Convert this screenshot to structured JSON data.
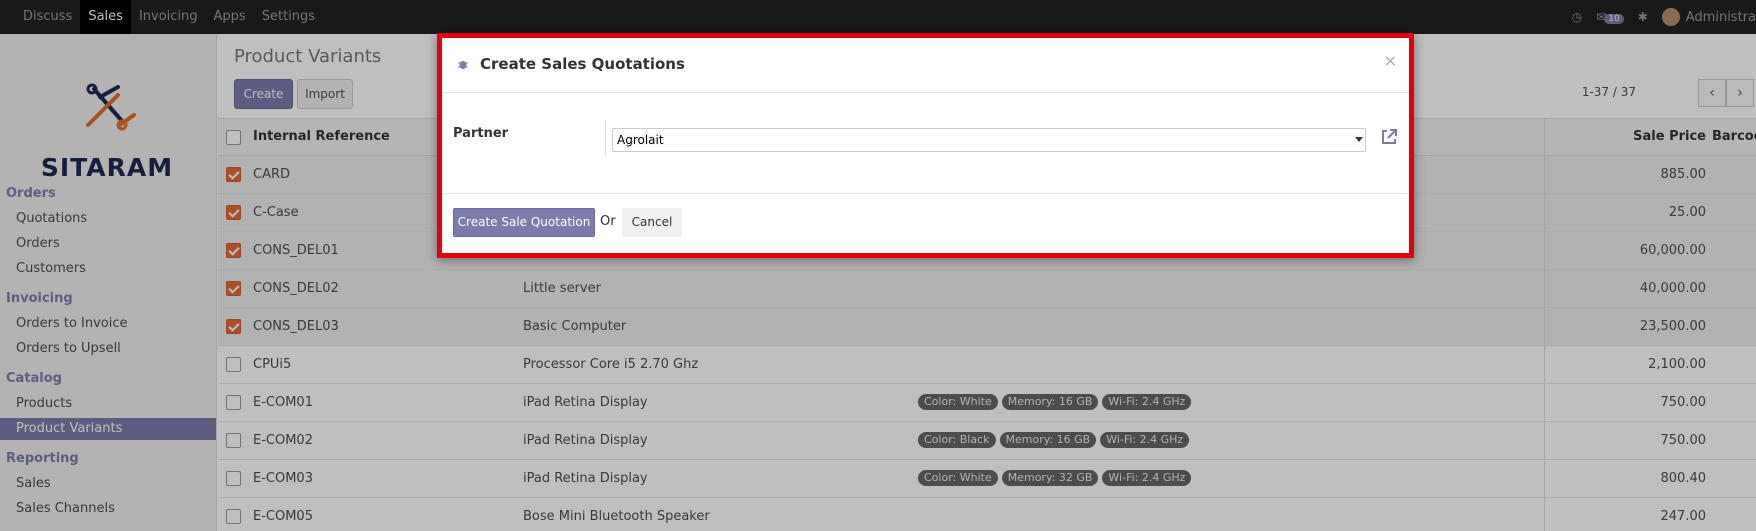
{
  "topbar": {
    "menu": [
      "Discuss",
      "Sales",
      "Invoicing",
      "Apps",
      "Settings"
    ],
    "active": "Sales",
    "message_count": "10",
    "user": "Administra"
  },
  "sidebar": {
    "logo_text": "SITARAM",
    "sections": [
      {
        "title": "Orders",
        "items": [
          "Quotations",
          "Orders",
          "Customers"
        ]
      },
      {
        "title": "Invoicing",
        "items": [
          "Orders to Invoice",
          "Orders to Upsell"
        ]
      },
      {
        "title": "Catalog",
        "items": [
          "Products",
          "Product Variants"
        ]
      },
      {
        "title": "Reporting",
        "items": [
          "Sales",
          "Sales Channels"
        ]
      }
    ],
    "active_item": "Product Variants"
  },
  "main": {
    "title": "Product Variants",
    "create_label": "Create",
    "import_label": "Import",
    "pager": "1-37 / 37",
    "columns": {
      "ref": "Internal Reference",
      "price": "Sale Price",
      "barcode": "Barcod"
    },
    "rows": [
      {
        "ref": "CARD",
        "name": "",
        "tags": [],
        "price": "885.00",
        "checked": true
      },
      {
        "ref": "C-Case",
        "name": "",
        "tags": [],
        "price": "25.00",
        "checked": true
      },
      {
        "ref": "CONS_DEL01",
        "name": "",
        "tags": [],
        "price": "60,000.00",
        "checked": true
      },
      {
        "ref": "CONS_DEL02",
        "name": "Little server",
        "tags": [],
        "price": "40,000.00",
        "checked": true
      },
      {
        "ref": "CONS_DEL03",
        "name": "Basic Computer",
        "tags": [],
        "price": "23,500.00",
        "checked": true
      },
      {
        "ref": "CPUi5",
        "name": "Processor Core i5 2.70 Ghz",
        "tags": [],
        "price": "2,100.00",
        "checked": false
      },
      {
        "ref": "E-COM01",
        "name": "iPad Retina Display",
        "tags": [
          "Color: White",
          "Memory: 16 GB",
          "Wi-Fi: 2.4 GHz"
        ],
        "price": "750.00",
        "checked": false
      },
      {
        "ref": "E-COM02",
        "name": "iPad Retina Display",
        "tags": [
          "Color: Black",
          "Memory: 16 GB",
          "Wi-Fi: 2.4 GHz"
        ],
        "price": "750.00",
        "checked": false
      },
      {
        "ref": "E-COM03",
        "name": "iPad Retina Display",
        "tags": [
          "Color: White",
          "Memory: 32 GB",
          "Wi-Fi: 2.4 GHz"
        ],
        "price": "800.40",
        "checked": false
      },
      {
        "ref": "E-COM05",
        "name": "Bose Mini Bluetooth Speaker",
        "tags": [],
        "price": "247.00",
        "checked": false
      }
    ]
  },
  "dialog": {
    "title": "Create Sales Quotations",
    "close": "×",
    "partner_label": "Partner",
    "partner_value": "Agrolait",
    "submit_label": "Create Sale Quotation",
    "or_label": "Or",
    "cancel_label": "Cancel"
  },
  "colors": {
    "accent": "#7c7bad",
    "highlight_border": "#e0000f",
    "checkbox": "#e06c3a"
  }
}
